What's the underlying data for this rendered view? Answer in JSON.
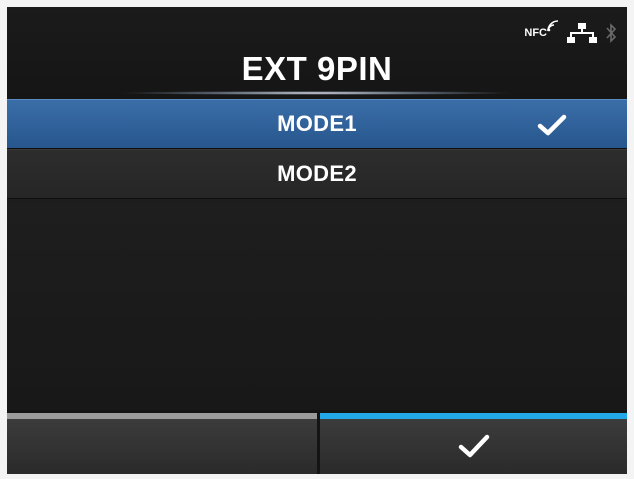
{
  "header": {
    "title": "EXT 9PIN",
    "status": {
      "nfc_label": "NFC",
      "icons": [
        "nfc-icon",
        "network-icon",
        "bluetooth-icon"
      ]
    }
  },
  "options": [
    {
      "label": "MODE1",
      "selected": true
    },
    {
      "label": "MODE2",
      "selected": false
    }
  ],
  "buttons": {
    "left": {
      "label": "",
      "accent": "#9b9b9b"
    },
    "right": {
      "icon": "checkmark-icon",
      "accent": "#23a7e8"
    }
  },
  "colors": {
    "selection": "#2f62a0",
    "background": "#1d1d1d",
    "accent_blue": "#23a7e8"
  }
}
